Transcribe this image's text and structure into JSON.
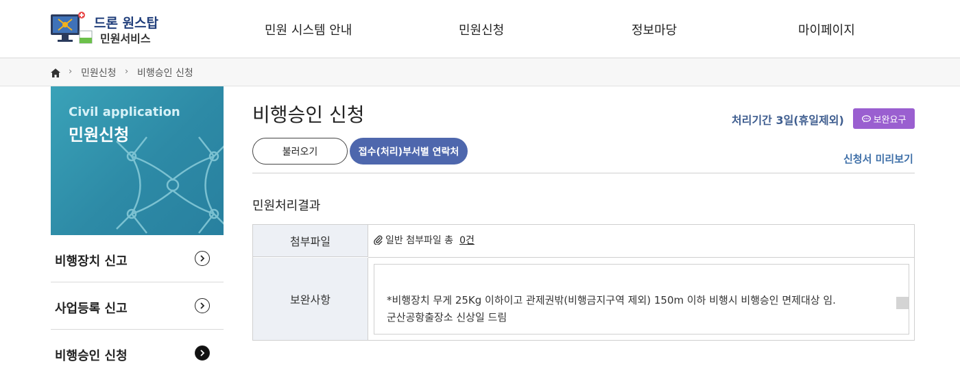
{
  "header": {
    "logo_line1": "드론 원스탑",
    "logo_line2": "민원서비스",
    "nav": [
      "민원 시스템 안내",
      "민원신청",
      "정보마당",
      "마이페이지"
    ]
  },
  "breadcrumb": {
    "items": [
      "민원신청",
      "비행승인 신청"
    ]
  },
  "sidebar": {
    "banner_en": "Civil application",
    "banner_ko": "민원신청",
    "items": [
      {
        "label": "비행장치 신고",
        "active": false
      },
      {
        "label": "사업등록 신고",
        "active": false
      },
      {
        "label": "비행승인 신청",
        "active": true
      }
    ]
  },
  "main": {
    "title": "비행승인 신청",
    "processing_period": "처리기간 3일(휴일제외)",
    "supplement_button": "보완요구",
    "load_button": "불러오기",
    "contact_button": "접수(처리)부서별 연락처",
    "preview_link": "신청서 미리보기",
    "section_title": "민원처리결과",
    "table": {
      "row1_header": "첨부파일",
      "attach_label": "일반 첨부파일 총",
      "attach_count": "0건",
      "row2_header": "보완사항",
      "supplement_lines": [
        "",
        "*비행장치 무게 25Kg 이하이고 관제권밖(비행금지구역 제외) 150m 이하 비행시 비행승인 면제대상 임.",
        "군산공항출장소  신상일 드림"
      ]
    }
  },
  "colors": {
    "accent_blue": "#4e67ad",
    "purple_button": "#9a5fd0",
    "period_text": "#3e5d8f",
    "banner_teal": "#2d8aa6"
  }
}
